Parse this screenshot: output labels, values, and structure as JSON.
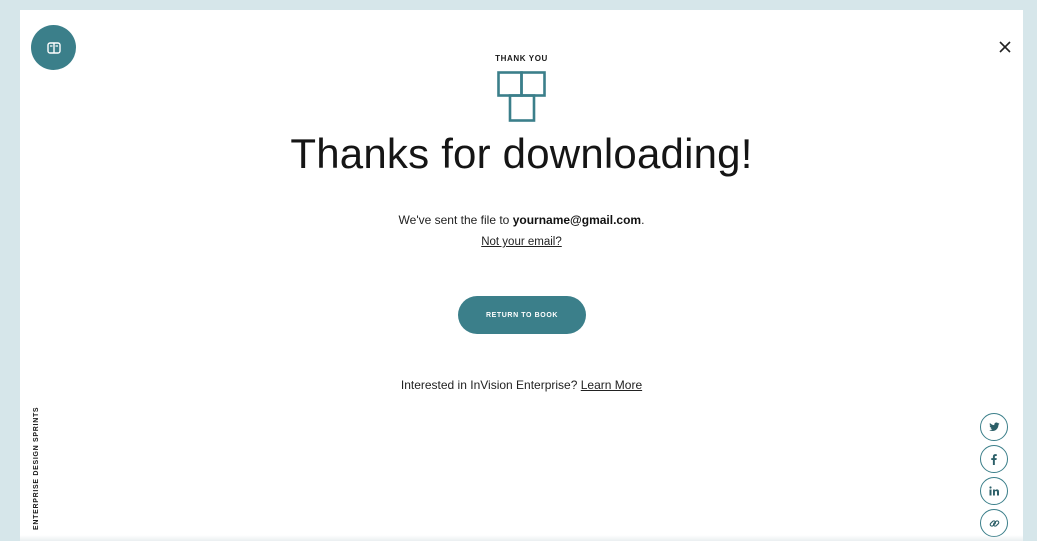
{
  "header": {
    "eyebrow": "THANK YOU",
    "headline": "Thanks for downloading!"
  },
  "message": {
    "sent_prefix": "We've sent the file to ",
    "email": "yourname@gmail.com",
    "sent_suffix": ".",
    "not_your_email": "Not your email?"
  },
  "actions": {
    "return_label": "RETURN TO BOOK"
  },
  "enterprise": {
    "prompt": "Interested in InVision Enterprise? ",
    "learn_more": "Learn More"
  },
  "sidebar": {
    "vertical_label": "ENTERPRISE DESIGN SPRINTS"
  },
  "social": [
    {
      "icon": "twitter-icon",
      "glyph": "t"
    },
    {
      "icon": "facebook-icon",
      "glyph": "f"
    },
    {
      "icon": "linkedin-icon",
      "glyph": "in"
    },
    {
      "icon": "link-icon",
      "glyph": "link"
    }
  ],
  "colors": {
    "accent": "#3b7f8a",
    "frame_background": "#d6e6ea",
    "text": "#151515"
  }
}
